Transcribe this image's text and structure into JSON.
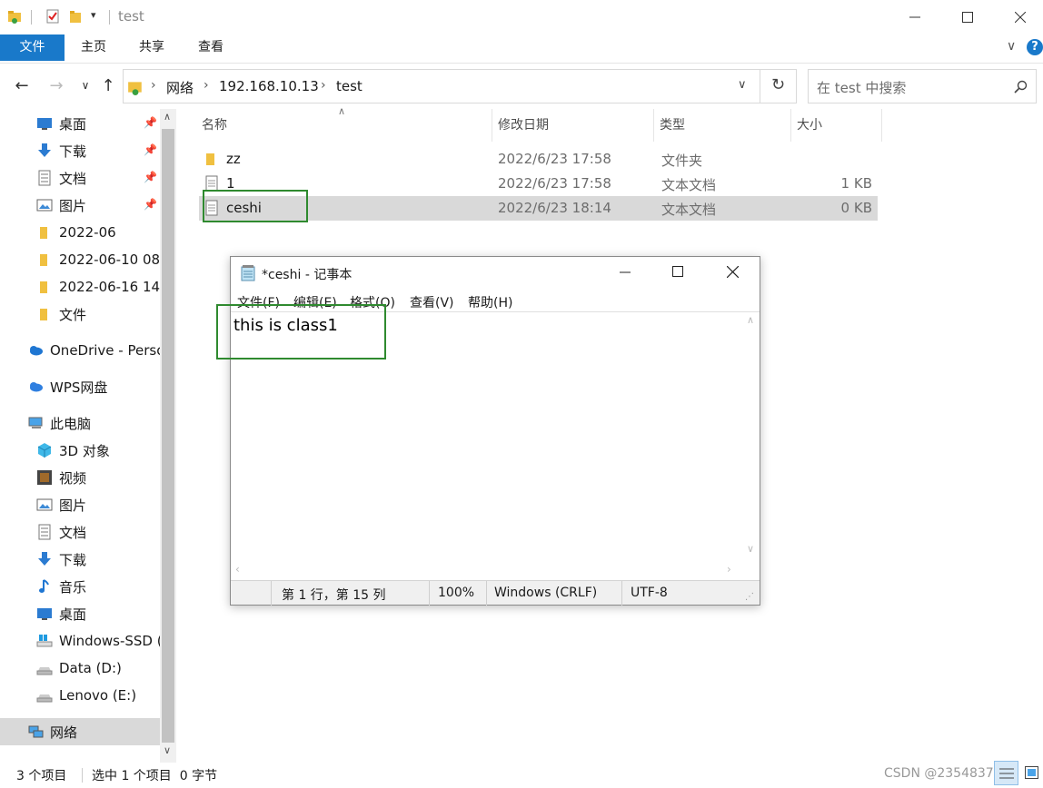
{
  "window": {
    "title": "test"
  },
  "ribbon": {
    "tabs": [
      "文件",
      "主页",
      "共享",
      "查看"
    ]
  },
  "address": {
    "crumbs": [
      "网络",
      "192.168.10.13",
      "test"
    ]
  },
  "search": {
    "placeholder": "在 test 中搜索"
  },
  "nav_pane": {
    "quick_access": [
      {
        "label": "桌面",
        "icon": "desktop-icon",
        "pinned": true
      },
      {
        "label": "下载",
        "icon": "download-icon",
        "pinned": true
      },
      {
        "label": "文档",
        "icon": "document-icon",
        "pinned": true
      },
      {
        "label": "图片",
        "icon": "pictures-icon",
        "pinned": true
      },
      {
        "label": "2022-06",
        "icon": "folder-icon",
        "pinned": false
      },
      {
        "label": "2022-06-10 08.",
        "icon": "folder-icon",
        "pinned": false
      },
      {
        "label": "2022-06-16 14.",
        "icon": "folder-icon",
        "pinned": false
      },
      {
        "label": "文件",
        "icon": "folder-icon",
        "pinned": false
      }
    ],
    "onedrive": "OneDrive - Perso",
    "wps": "WPS网盘",
    "this_pc": "此电脑",
    "pc_items": [
      {
        "label": "3D 对象",
        "icon": "3d-objects-icon"
      },
      {
        "label": "视频",
        "icon": "video-icon"
      },
      {
        "label": "图片",
        "icon": "pictures-icon"
      },
      {
        "label": "文档",
        "icon": "document-icon"
      },
      {
        "label": "下载",
        "icon": "download-icon"
      },
      {
        "label": "音乐",
        "icon": "music-icon"
      },
      {
        "label": "桌面",
        "icon": "desktop-icon"
      },
      {
        "label": "Windows-SSD (",
        "icon": "windows-drive-icon"
      },
      {
        "label": "Data (D:)",
        "icon": "drive-icon"
      },
      {
        "label": "Lenovo (E:)",
        "icon": "drive-icon"
      }
    ],
    "network": "网络"
  },
  "file_list": {
    "headers": {
      "name": "名称",
      "date": "修改日期",
      "type": "类型",
      "size": "大小"
    },
    "rows": [
      {
        "name": "zz",
        "date": "2022/6/23 17:58",
        "type": "文件夹",
        "size": "",
        "icon": "folder-icon"
      },
      {
        "name": "1",
        "date": "2022/6/23 17:58",
        "type": "文本文档",
        "size": "1 KB",
        "icon": "text-file-icon"
      },
      {
        "name": "ceshi",
        "date": "2022/6/23 18:14",
        "type": "文本文档",
        "size": "0 KB",
        "icon": "text-file-icon"
      }
    ]
  },
  "status": {
    "count": "3 个项目",
    "selection": "选中 1 个项目  0 字节"
  },
  "notepad": {
    "title": "*ceshi - 记事本",
    "menus": [
      "文件(F)",
      "编辑(E)",
      "格式(O)",
      "查看(V)",
      "帮助(H)"
    ],
    "content": "this is class1",
    "status": {
      "position": "第 1 行，第 15 列",
      "zoom": "100%",
      "line_ending": "Windows (CRLF)",
      "encoding": "UTF-8"
    }
  },
  "watermark": "CSDN @2354837",
  "colors": {
    "accent": "#1979ca",
    "highlight_box": "#2f8a2f",
    "selection": "#d9d9d9"
  }
}
